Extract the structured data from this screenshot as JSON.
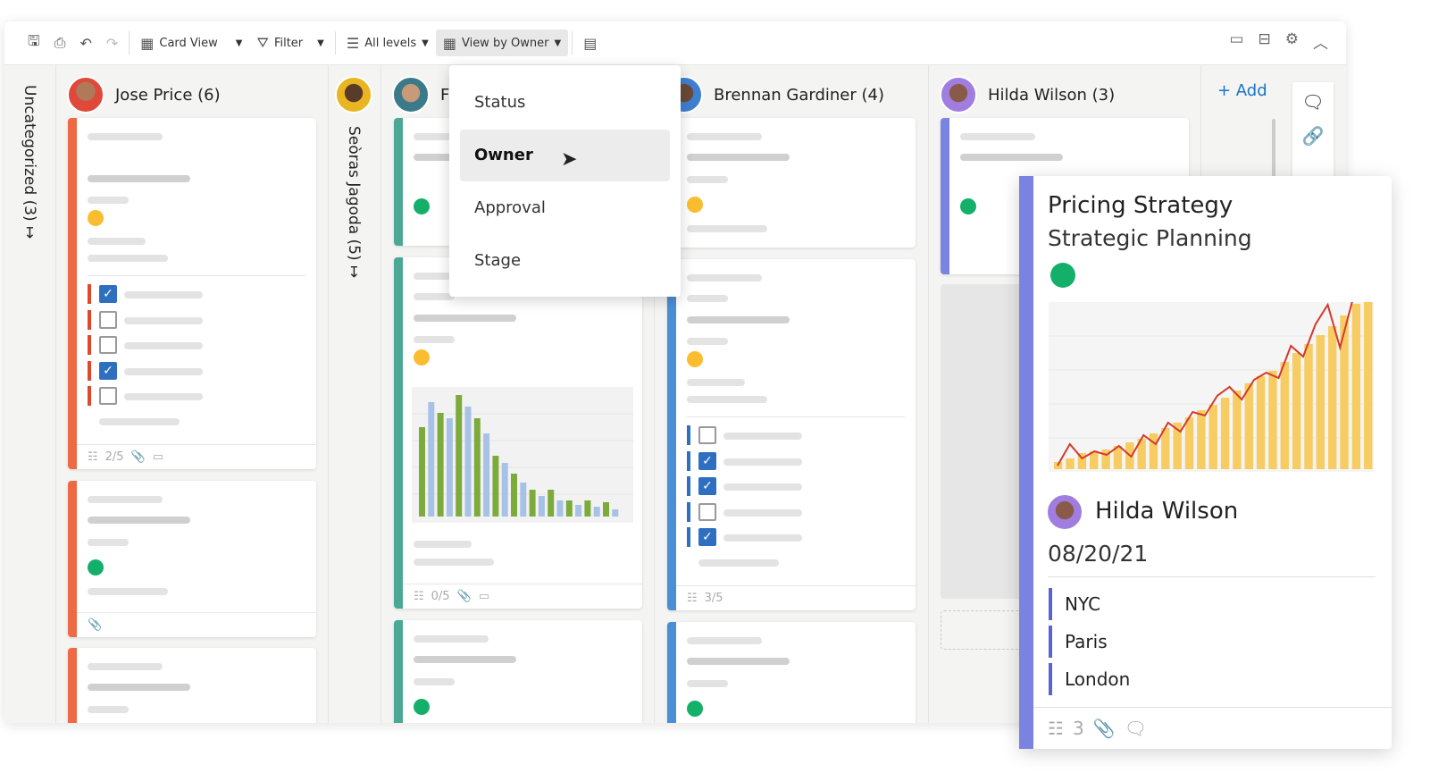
{
  "toolbar": {
    "card_view": "Card View",
    "filter": "Filter",
    "all_levels": "All levels",
    "view_by": "View by Owner"
  },
  "columns": {
    "uncategorized": "Uncategorized (3)",
    "jose": "Jose Price (6)",
    "seoras": "Seòras Jagoda (5)",
    "f": "F",
    "brennan": "Brennan Gardiner (4)",
    "hilda": "Hilda Wilson (3)",
    "add": "+ Add"
  },
  "card_footers": {
    "jose": "2/5",
    "f": "0/5",
    "brennan": "3/5"
  },
  "dropdown": {
    "items": [
      "Status",
      "Owner",
      "Approval",
      "Stage"
    ],
    "selected": "Owner"
  },
  "popup": {
    "title": "Pricing Strategy",
    "subtitle": "Strategic Planning",
    "owner": "Hilda Wilson",
    "date": "08/20/21",
    "locations": [
      "NYC",
      "Paris",
      "London"
    ],
    "checklist_count": "3",
    "status_color": "#14b06a"
  },
  "colors": {
    "orange": "#ee6a45",
    "teal": "#4aa895",
    "blue": "#4a8fd6",
    "purple": "#7b83e0",
    "green": "#14b06a",
    "yellow": "#fbbd30",
    "accent": "#1a73c6"
  },
  "mini_chart": {
    "series_a_color": "#7cab3c",
    "series_b_color": "#a8c1e6",
    "values": [
      100,
      128,
      116,
      110,
      136,
      123,
      110,
      93,
      68,
      60,
      48,
      38,
      30,
      23,
      30,
      18,
      18,
      13,
      18,
      11,
      16,
      8
    ]
  },
  "popup_chart": {
    "bar_color": "#f7cd63",
    "line_color": "#d33a2c",
    "bars": [
      8,
      12,
      18,
      20,
      22,
      26,
      30,
      34,
      40,
      46,
      52,
      58,
      66,
      72,
      80,
      88,
      96,
      104,
      110,
      120,
      130,
      140,
      150,
      160,
      172,
      185,
      188
    ],
    "line": [
      4,
      28,
      12,
      20,
      16,
      26,
      14,
      38,
      28,
      52,
      42,
      64,
      60,
      82,
      92,
      78,
      100,
      108,
      102,
      138,
      126,
      162,
      184,
      136,
      188
    ]
  }
}
